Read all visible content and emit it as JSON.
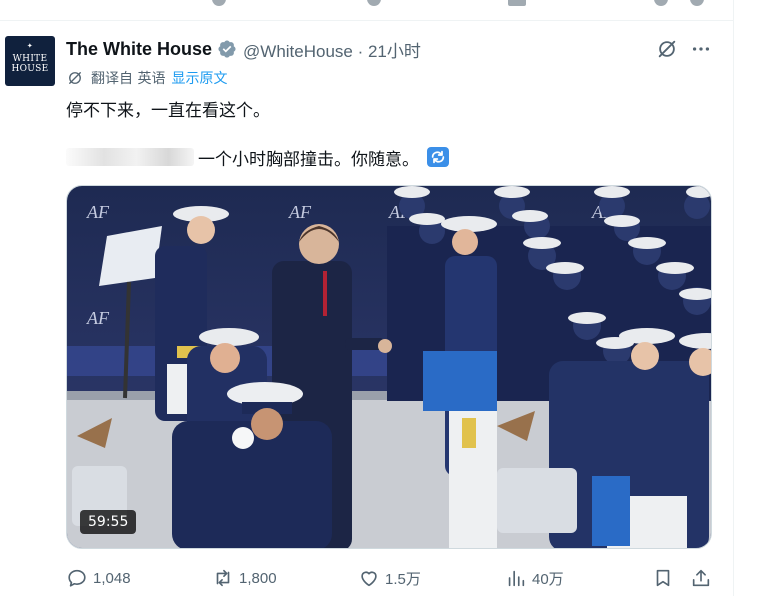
{
  "tweet": {
    "author_name": "The White House",
    "handle_time": "@WhiteHouse · 21小时",
    "avatar_lines": [
      "WHITE",
      "HOUSE"
    ],
    "translate_label": "翻译自 英语",
    "show_original": "显示原文",
    "text_line1": "停不下来，一直在看这个。",
    "text_line2_tail": "一个小时胸部撞击。你随意。"
  },
  "media": {
    "duration": "59:55",
    "banner_text": "AF"
  },
  "actions": {
    "replies": "1,048",
    "retweets": "1,800",
    "likes": "1.5万",
    "views": "40万"
  },
  "colors": {
    "text": "#0f1419",
    "secondary": "#536471",
    "link": "#1d9bf0",
    "verified_badge": "#829aab",
    "avatar_bg": "#10213d"
  }
}
